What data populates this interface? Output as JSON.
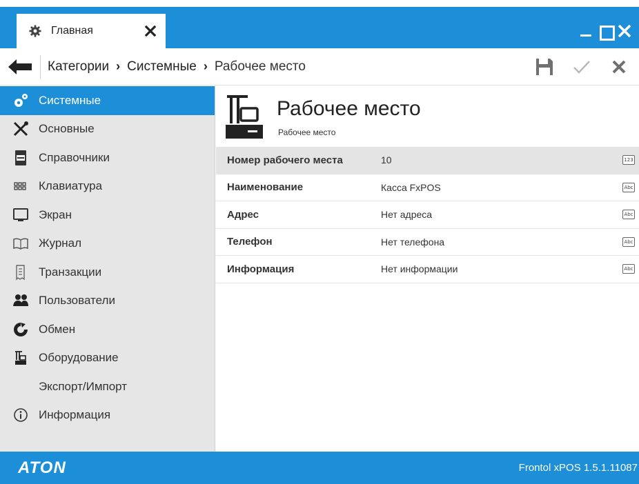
{
  "window": {
    "tab_label": "Главная"
  },
  "breadcrumb": {
    "items": [
      "Категории",
      "Системные"
    ],
    "current": "Рабочее место"
  },
  "sidebar": {
    "items": [
      {
        "label": "Системные",
        "icon": "gears-icon",
        "active": true
      },
      {
        "label": "Основные",
        "icon": "tools-icon"
      },
      {
        "label": "Справочники",
        "icon": "book-icon"
      },
      {
        "label": "Клавиатура",
        "icon": "keyboard-icon"
      },
      {
        "label": "Экран",
        "icon": "monitor-icon"
      },
      {
        "label": "Журнал",
        "icon": "journal-icon"
      },
      {
        "label": "Транзакции",
        "icon": "receipt-icon"
      },
      {
        "label": "Пользователи",
        "icon": "users-icon"
      },
      {
        "label": "Обмен",
        "icon": "exchange-icon"
      },
      {
        "label": "Оборудование",
        "icon": "cash-register-icon"
      },
      {
        "label": "Экспорт/Импорт",
        "icon": ""
      },
      {
        "label": "Информация",
        "icon": "info-icon"
      }
    ]
  },
  "content": {
    "title": "Рабочее место",
    "subtitle": "Рабочее место",
    "rows": [
      {
        "label": "Номер рабочего места",
        "value": "10",
        "type": "123"
      },
      {
        "label": "Наименование",
        "value": "Касса FxPOS",
        "type": "Abc"
      },
      {
        "label": "Адрес",
        "value": "Нет адреса",
        "type": "Abc"
      },
      {
        "label": "Телефон",
        "value": "Нет телефона",
        "type": "Abc"
      },
      {
        "label": "Информация",
        "value": "Нет информации",
        "type": "Abc"
      }
    ]
  },
  "statusbar": {
    "logo": "ATON",
    "version": "Frontol xPOS 1.5.1.11087"
  },
  "colors": {
    "accent": "#1d8fd8",
    "sidebar_bg": "#e6e6e6"
  }
}
